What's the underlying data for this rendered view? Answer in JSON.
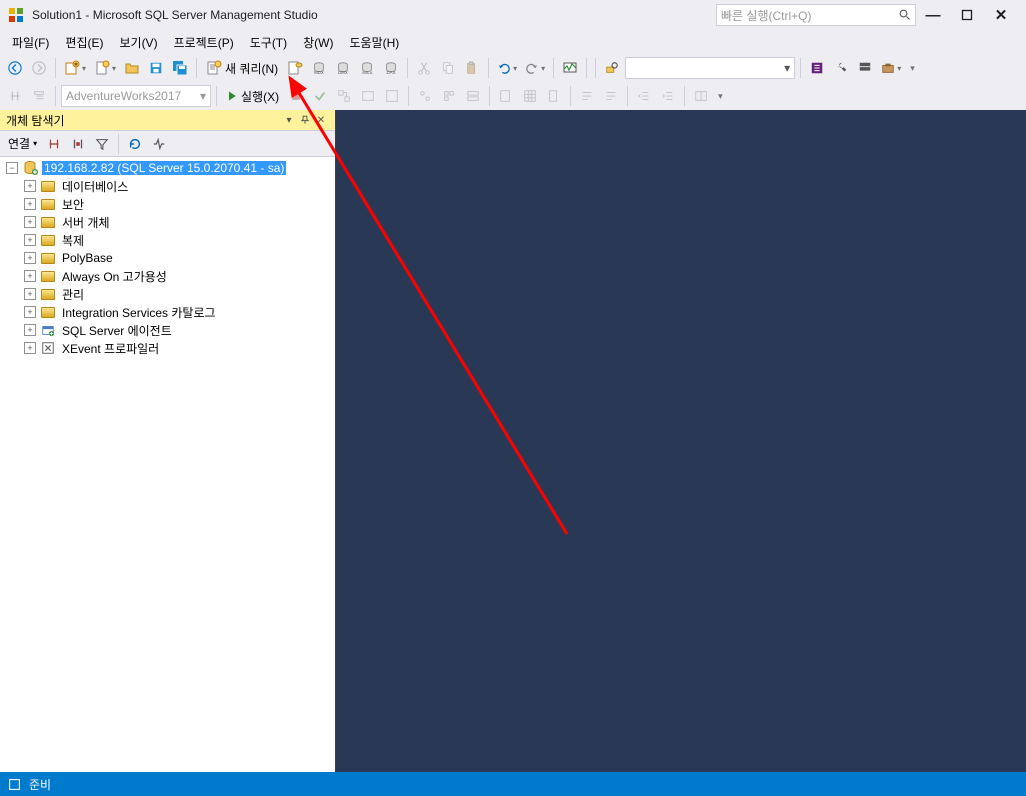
{
  "titlebar": {
    "title": "Solution1 - Microsoft SQL Server Management Studio",
    "search_placeholder": "빠른 실행(Ctrl+Q)"
  },
  "menubar": {
    "items": [
      "파일(F)",
      "편집(E)",
      "보기(V)",
      "프로젝트(P)",
      "도구(T)",
      "창(W)",
      "도움말(H)"
    ]
  },
  "toolbar1": {
    "new_query": "새 쿼리(N)",
    "database_combo": "AdventureWorks2017",
    "execute": "실행(X)"
  },
  "object_explorer": {
    "title": "개체 탐색기",
    "connect_label": "연결",
    "root": "192.168.2.82 (SQL Server 15.0.2070.41 - sa)",
    "nodes": [
      "데이터베이스",
      "보안",
      "서버 개체",
      "복제",
      "PolyBase",
      "Always On 고가용성",
      "관리",
      "Integration Services 카탈로그",
      "SQL Server 에이전트",
      "XEvent 프로파일러"
    ]
  },
  "statusbar": {
    "message": "준비"
  }
}
